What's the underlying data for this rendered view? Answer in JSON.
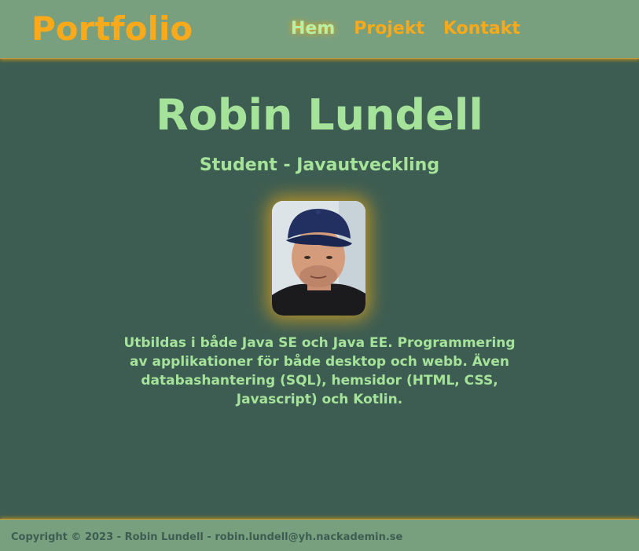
{
  "header": {
    "logo": "Portfolio",
    "nav": [
      {
        "label": "Hem",
        "active": true
      },
      {
        "label": "Projekt",
        "active": false
      },
      {
        "label": "Kontakt",
        "active": false
      }
    ]
  },
  "hero": {
    "name": "Robin Lundell",
    "subtitle": "Student - Javautveckling",
    "photo_icon": "profile-photo",
    "description": "Utbildas i både Java SE och Java EE. Programmering av applikationer för både desktop och webb. Även databashantering (SQL), hemsidor (HTML, CSS, Javascript) och Kotlin."
  },
  "footer": {
    "text": "Copyright © 2023 - Robin Lundell - robin.lundell@yh.nackademin.se"
  },
  "colors": {
    "background": "#3e5d52",
    "bar": "#78a07f",
    "accent": "#f9a91a",
    "text": "#a6e39a"
  }
}
